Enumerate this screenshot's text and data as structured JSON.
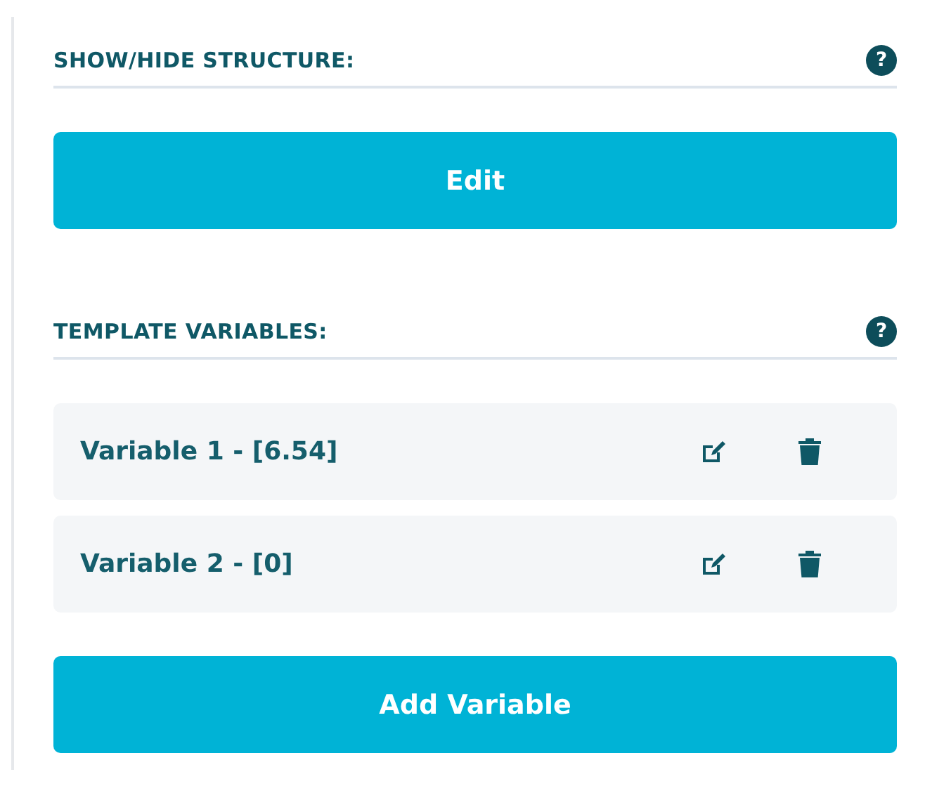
{
  "sections": [
    {
      "title": "SHOW/HIDE STRUCTURE:",
      "help_icon": "?",
      "button": "Edit"
    },
    {
      "title": "TEMPLATE VARIABLES:",
      "help_icon": "?",
      "variables": [
        {
          "label": "Variable 1 - [6.54]"
        },
        {
          "label": "Variable 2 - [0]"
        }
      ],
      "button": "Add Variable"
    }
  ]
}
